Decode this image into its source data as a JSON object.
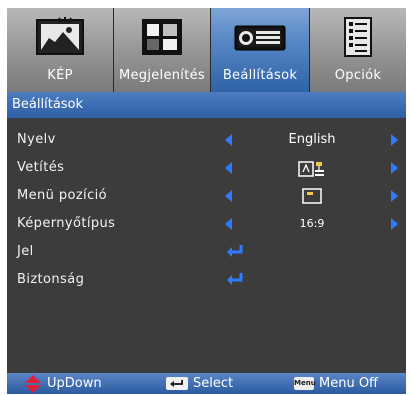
{
  "tabs": [
    {
      "label": "KÉP",
      "icon": "picture-icon",
      "active": false
    },
    {
      "label": "Megjelenítés",
      "icon": "display-icon",
      "active": false
    },
    {
      "label": "Beállítások",
      "icon": "projector-icon",
      "active": true
    },
    {
      "label": "Opciók",
      "icon": "options-list-icon",
      "active": false
    }
  ],
  "section_title": "Beállítások",
  "rows": [
    {
      "label": "Nyelv",
      "value": "English"
    },
    {
      "label": "Vetítés",
      "value_icon": "projection-mode-icon"
    },
    {
      "label": "Menü pozíció",
      "value_icon": "menu-position-icon"
    },
    {
      "label": "Képernyőtípus",
      "value": "16:9"
    },
    {
      "label": "Jel",
      "action_icon": "enter-icon"
    },
    {
      "label": "Biztonság",
      "action_icon": "enter-icon"
    }
  ],
  "footer": {
    "updown": "UpDown",
    "select": "Select",
    "menu_key": "Menu",
    "menu_off": "Menu Off"
  },
  "colors": {
    "accent_blue": "#2e5fa6",
    "active_tab": "#5686c4",
    "arrow": "#2f7bff",
    "updown_red": "#e0203a",
    "background": "#3c3c3c"
  }
}
